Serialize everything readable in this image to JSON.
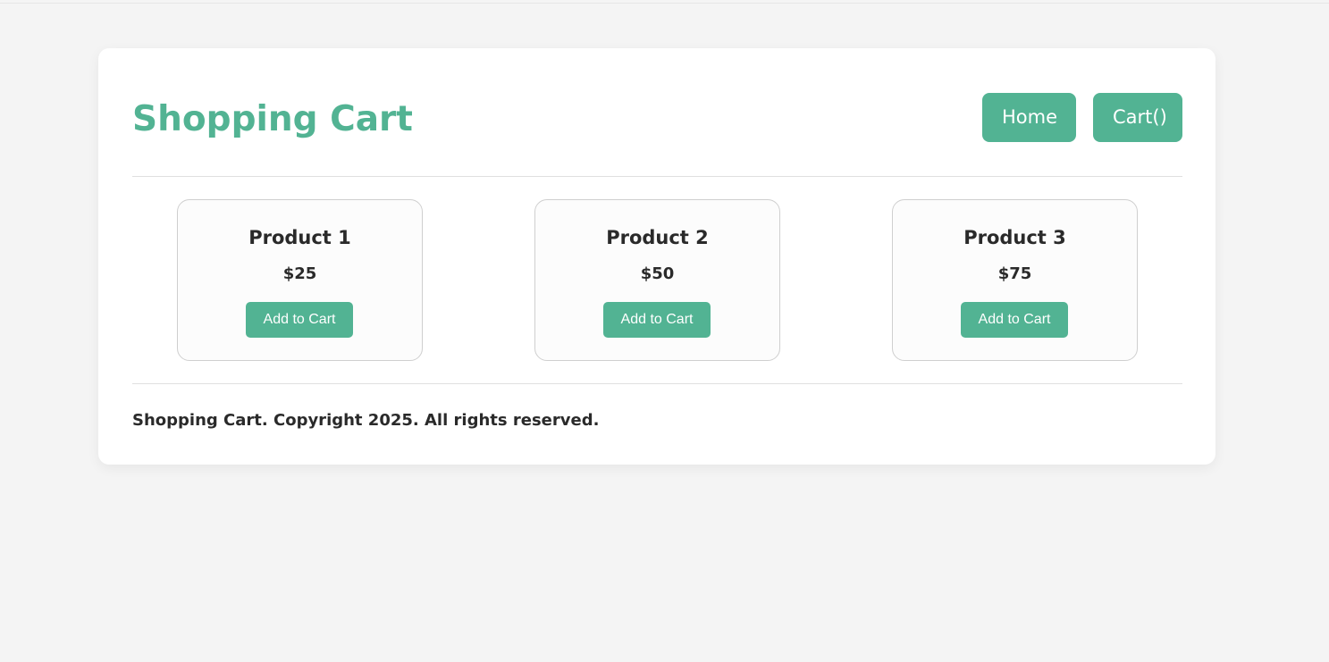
{
  "header": {
    "title": "Shopping Cart",
    "nav": {
      "home_label": "Home",
      "cart_label": "Cart()"
    }
  },
  "products": [
    {
      "name": "Product 1",
      "price": "$25",
      "button_label": "Add to Cart"
    },
    {
      "name": "Product 2",
      "price": "$50",
      "button_label": "Add to Cart"
    },
    {
      "name": "Product 3",
      "price": "$75",
      "button_label": "Add to Cart"
    }
  ],
  "footer": {
    "text": "Shopping Cart. Copyright 2025. All rights reserved."
  },
  "colors": {
    "accent": "#52b393",
    "background": "#f4f4f4",
    "card_background": "#fcfcfc",
    "text": "#2a2a2a"
  }
}
